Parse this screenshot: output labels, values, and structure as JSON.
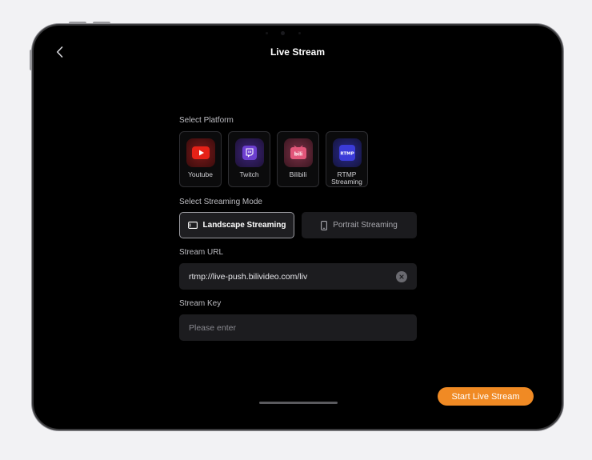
{
  "header": {
    "title": "Live Stream",
    "back_icon": "chevron-left-icon"
  },
  "platform_section": {
    "label": "Select Platform",
    "items": [
      {
        "label": "Youtube",
        "icon": "youtube-icon",
        "color": "#e62117"
      },
      {
        "label": "Twitch",
        "icon": "twitch-icon",
        "color": "#6d3fd0"
      },
      {
        "label": "Bilibili",
        "icon": "bilibili-icon",
        "color": "#e2567a"
      },
      {
        "label": "RTMP Streaming",
        "icon": "rtmp-icon",
        "color": "#3b3bd8",
        "icon_text": "RTMP"
      }
    ]
  },
  "mode_section": {
    "label": "Select Streaming Mode",
    "landscape": "Landscape Streaming",
    "portrait": "Portrait Streaming",
    "selected": "Landscape Streaming"
  },
  "stream_url": {
    "label": "Stream URL",
    "value": "rtmp://live-push.bilivideo.com/liv"
  },
  "stream_key": {
    "label": "Stream Key",
    "value": "",
    "placeholder": "Please enter"
  },
  "actions": {
    "start_label": "Start Live Stream",
    "accent": "#f08a24"
  }
}
